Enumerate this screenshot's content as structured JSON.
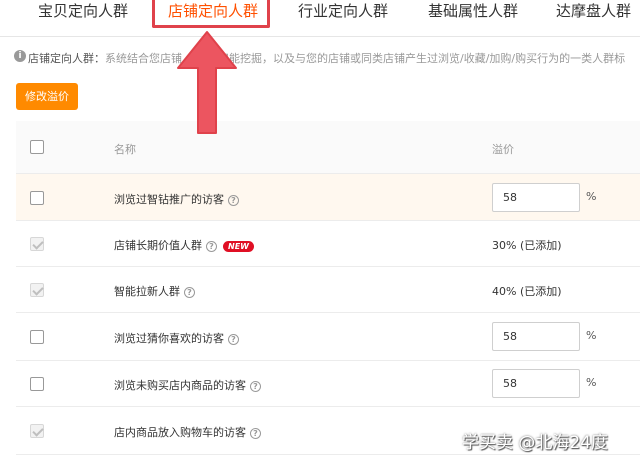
{
  "tabs": [
    {
      "label": "宝贝定向人群",
      "active": false
    },
    {
      "label": "店铺定向人群",
      "active": true
    },
    {
      "label": "行业定向人群",
      "active": false
    },
    {
      "label": "基础属性人群",
      "active": false
    },
    {
      "label": "达摩盘人群",
      "active": false
    }
  ],
  "notice": {
    "label": "店铺定向人群：",
    "text": "系统结合您店铺... 证而智能挖掘，以及与您的店铺或同类店铺产生过浏览/收藏/加购/购买行为的一类人群标"
  },
  "toolbar": {
    "modify_button": "修改溢价"
  },
  "table": {
    "headers": {
      "name": "名称",
      "premium": "溢价"
    },
    "rows": [
      {
        "name": "浏览过智钻推广的访客",
        "help": "?",
        "premium": "58",
        "unit": "%",
        "added_text": "",
        "badge": "",
        "checked": false,
        "disabled": false
      },
      {
        "name": "店铺长期价值人群",
        "help": "?",
        "premium": "",
        "unit": "",
        "added_text": "30% (已添加)",
        "badge": "NEW",
        "checked": true,
        "disabled": true
      },
      {
        "name": "智能拉新人群",
        "help": "?",
        "premium": "",
        "unit": "",
        "added_text": "40% (已添加)",
        "badge": "",
        "checked": true,
        "disabled": true
      },
      {
        "name": "浏览过猜你喜欢的访客",
        "help": "?",
        "premium": "58",
        "unit": "%",
        "added_text": "",
        "badge": "",
        "checked": false,
        "disabled": false
      },
      {
        "name": "浏览未购买店内商品的访客",
        "help": "?",
        "premium": "58",
        "unit": "%",
        "added_text": "",
        "badge": "",
        "checked": false,
        "disabled": false
      },
      {
        "name": "店内商品放入购物车的访客",
        "help": "?",
        "premium": "",
        "unit": "",
        "added_text": "",
        "badge": "",
        "checked": true,
        "disabled": true
      }
    ]
  },
  "watermark": "学买卖 @北海24度",
  "colors": {
    "accent": "#ff5000",
    "button": "#ff8a00",
    "annotation": "#e0424b",
    "badge": "#e00f24"
  }
}
